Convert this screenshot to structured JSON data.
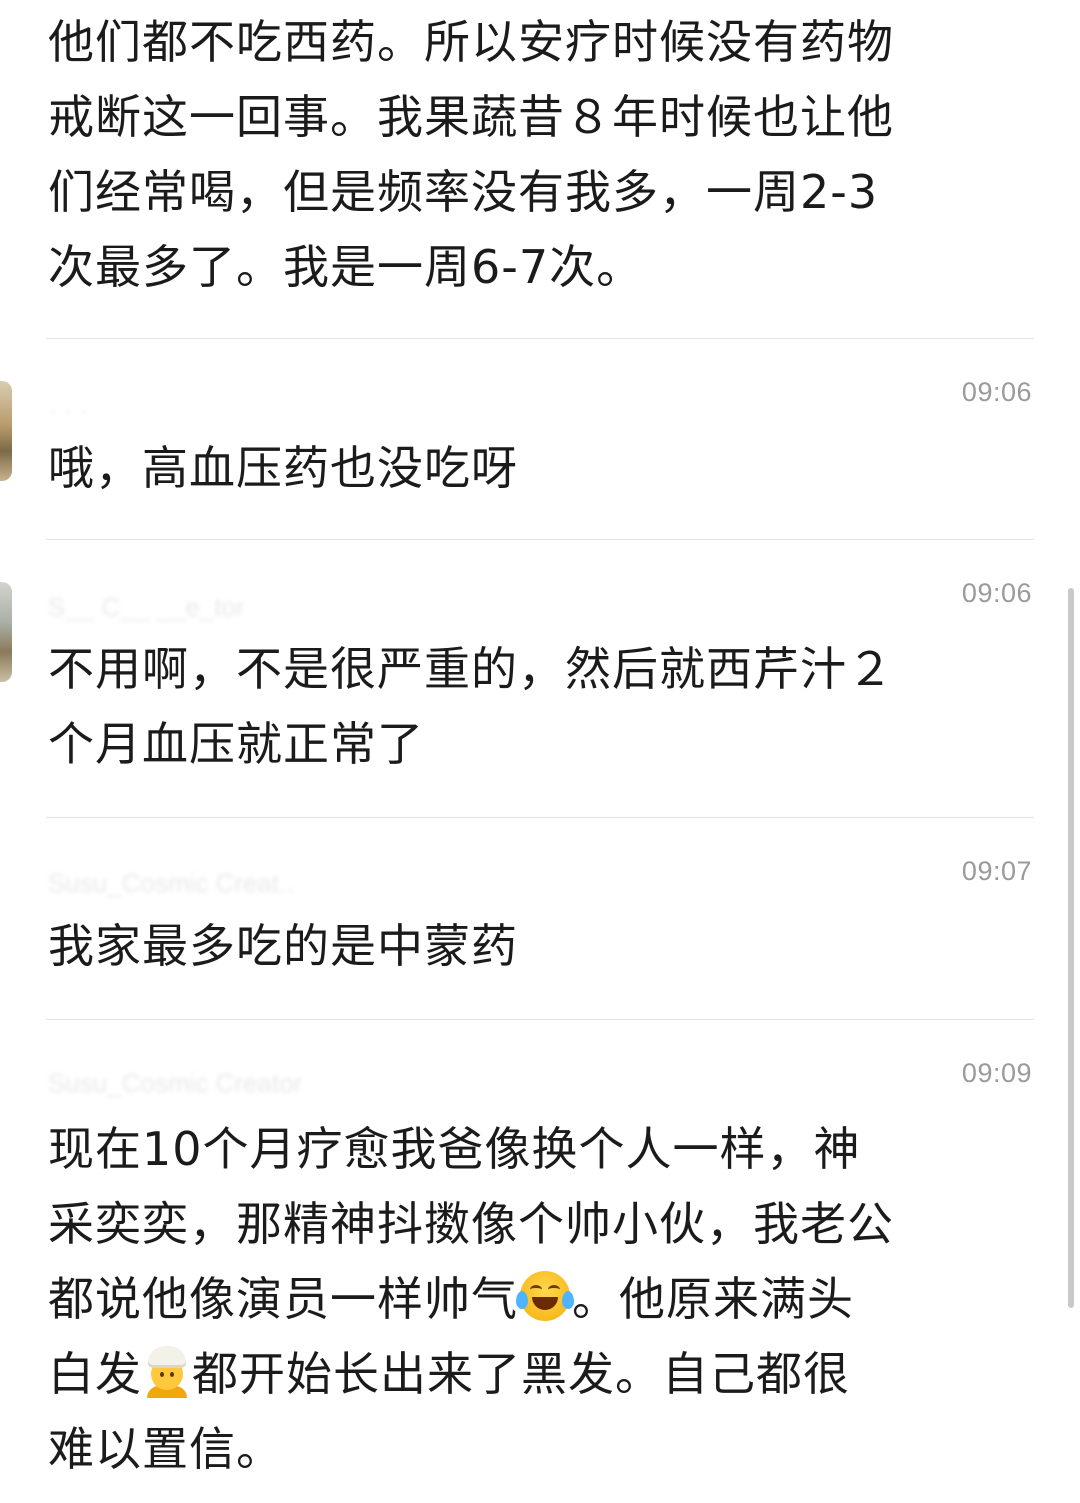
{
  "messages": [
    {
      "id": "m0",
      "lines": [
        "他们都不吃西药。所以安疗时候没有药物",
        "戒断这一回事。我果蔬昔８年时候也让他",
        "们经常喝，但是频率没有我多，一周2-3",
        "次最多了。我是一周6-7次。"
      ]
    },
    {
      "id": "m1",
      "time": "09:06",
      "sender": "· ·  ·",
      "lines": [
        "哦，高血压药也没吃呀"
      ]
    },
    {
      "id": "m2",
      "time": "09:06",
      "sender": "S__ C__ __e_tor",
      "lines": [
        "不用啊，不是很严重的，然后就西芹汁２",
        "个月血压就正常了"
      ]
    },
    {
      "id": "m3",
      "time": "09:07",
      "sender": "Susu_Cosmic Creat..",
      "lines": [
        "我家最多吃的是中蒙药"
      ]
    },
    {
      "id": "m4",
      "time": "09:09",
      "sender": "Susu_Cosmic Creator",
      "line1": "现在10个月疗愈我爸像换个人一样，神",
      "line2": "采奕奕，那精神抖擞像个帅小伙，我老公",
      "line3a": "都说他像演员一样帅气",
      "line3b": "。他原来满头",
      "line4a": "白发",
      "line4b": "都开始长出来了黑发。自己都很",
      "line5": "难以置信。",
      "emoji1": "face-with-tears-of-joy-icon",
      "emoji2": "older-person-icon"
    }
  ],
  "colors": {
    "text": "#1b1b1b",
    "time": "#9a9a9a",
    "divider": "#e4e4e4",
    "background": "#ffffff"
  }
}
